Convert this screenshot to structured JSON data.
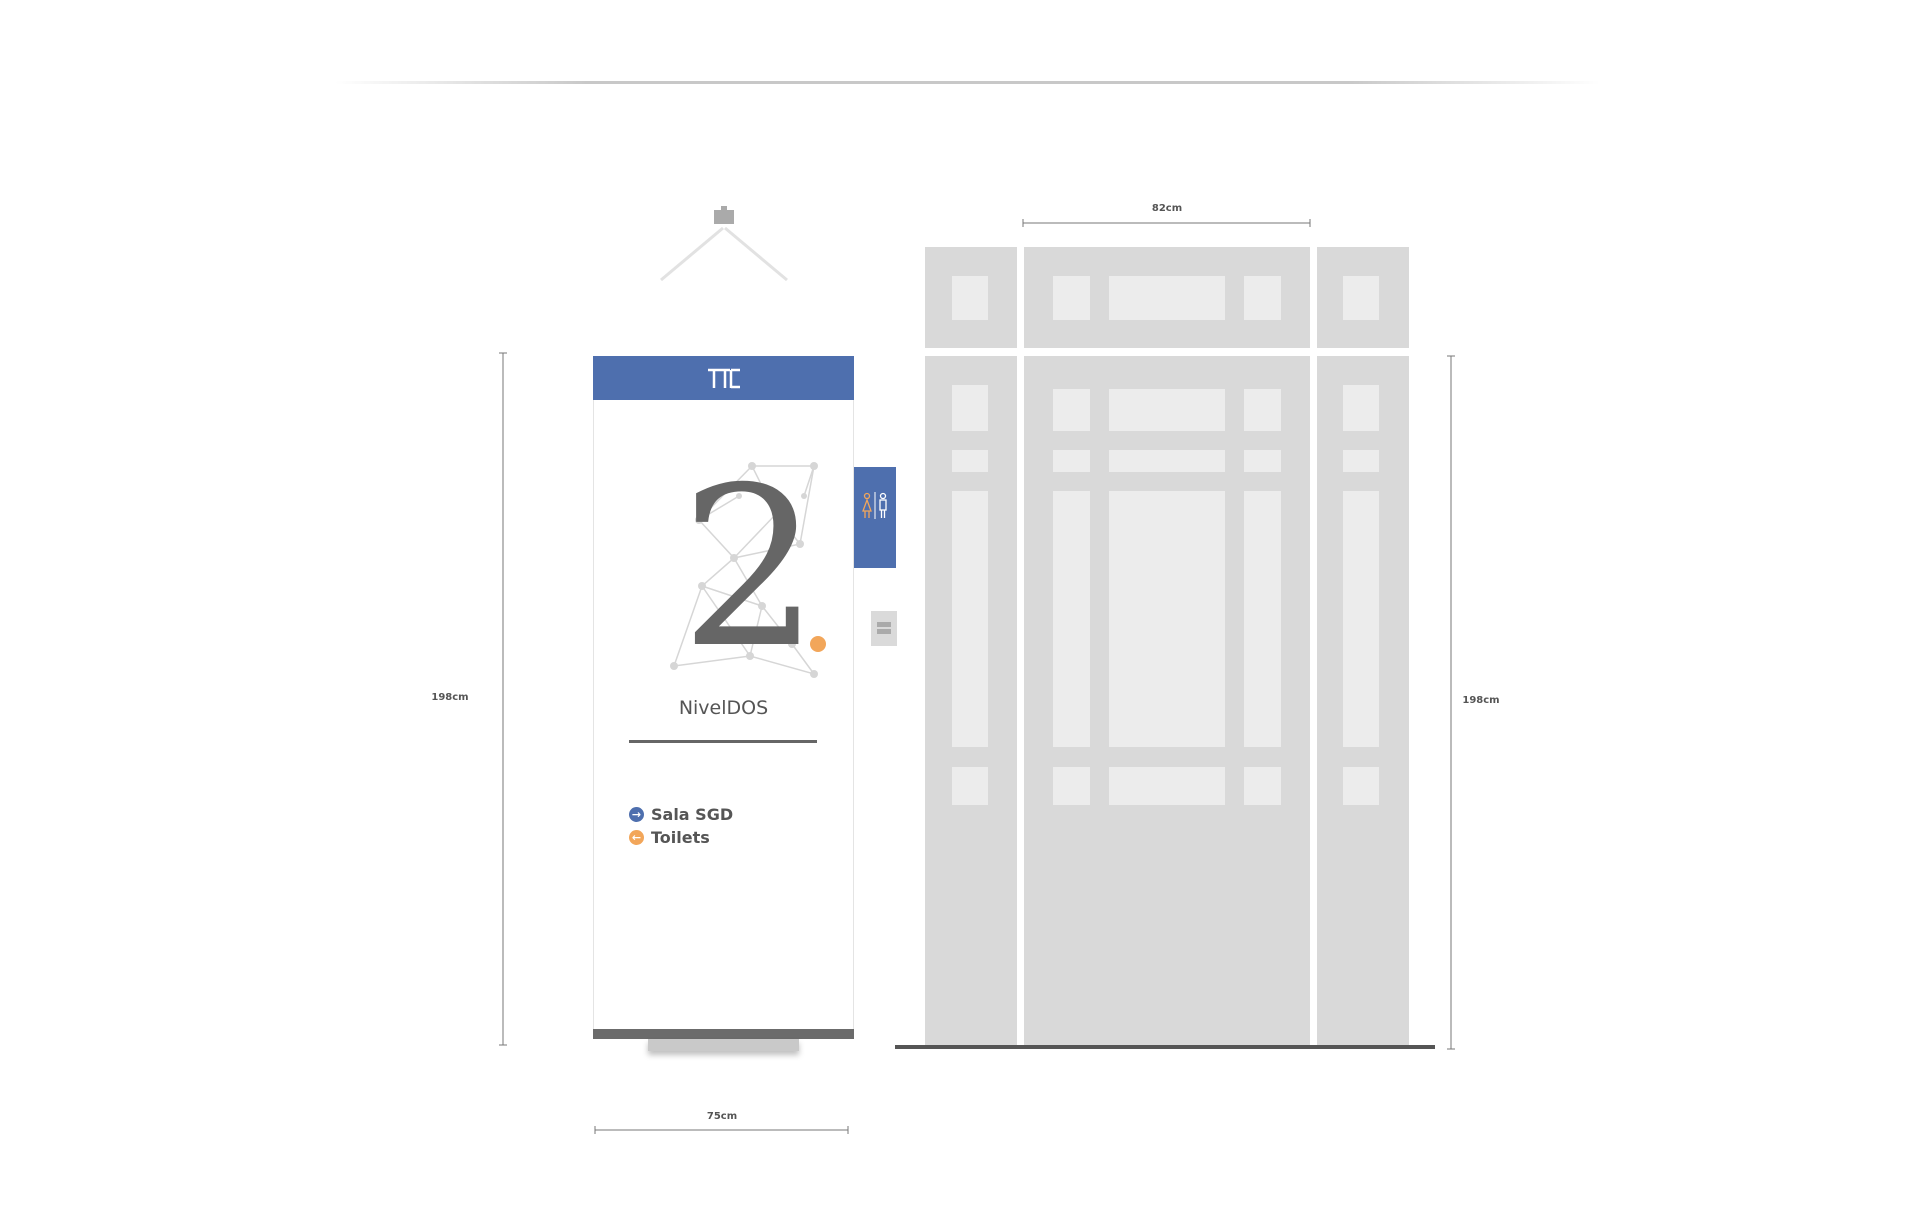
{
  "dimensions": {
    "door_width": "82cm",
    "banner_width": "75cm",
    "banner_height": "198cm",
    "door_height": "198cm"
  },
  "banner": {
    "level_number": "2",
    "level_name": "NivelDOS",
    "directions": [
      {
        "label": "Sala SGD",
        "direction": "right",
        "color": "#4e6fae"
      },
      {
        "label": "Toilets",
        "direction": "left",
        "color": "#f2a65a"
      }
    ],
    "logo_icon": "ttc-logo-icon",
    "accent_color": "#4e6fae",
    "dot_color": "#f2a65a"
  },
  "wall_sign": {
    "icon": "restroom-icon"
  }
}
